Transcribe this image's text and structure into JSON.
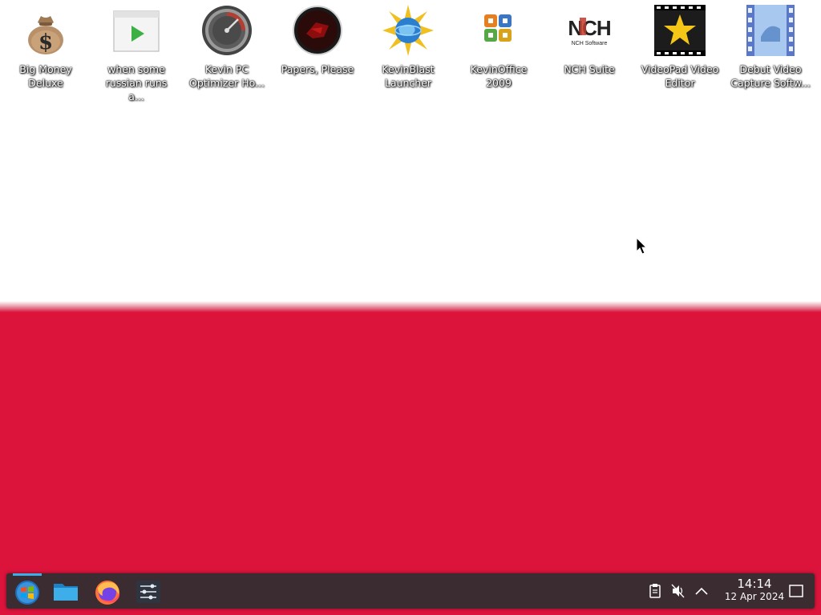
{
  "desktop": {
    "icons": [
      {
        "label": "Big Money Deluxe",
        "icon": "money-bag-icon"
      },
      {
        "label": "when some russian runs a...",
        "icon": "video-player-icon"
      },
      {
        "label": "Kevin PC Optimizer Ho...",
        "icon": "speedometer-icon"
      },
      {
        "label": "Papers, Please",
        "icon": "papers-please-emblem-icon"
      },
      {
        "label": "KevinBlast Launcher",
        "icon": "globe-star-icon"
      },
      {
        "label": "KevinOffice 2009",
        "icon": "office-logo-icon"
      },
      {
        "label": "NCH Suite",
        "icon": "nch-logo-icon"
      },
      {
        "label": "VideoPad Video Editor",
        "icon": "film-star-icon"
      },
      {
        "label": "Debut Video Capture Softw...",
        "icon": "film-strip-icon"
      }
    ],
    "nch_logo_text": "NCH",
    "nch_logo_sub": "NCH Software"
  },
  "wallpaper": {
    "top_color": "#ffffff",
    "bottom_color": "#dc143c"
  },
  "taskbar": {
    "apps": [
      {
        "name": "start-menu",
        "icon": "windows-orb-icon"
      },
      {
        "name": "file-manager",
        "icon": "folder-icon"
      },
      {
        "name": "firefox",
        "icon": "firefox-icon"
      },
      {
        "name": "system-settings",
        "icon": "settings-sliders-icon"
      }
    ],
    "tray": [
      {
        "icon": "clipboard-icon"
      },
      {
        "icon": "volume-muted-icon"
      },
      {
        "icon": "chevron-up-icon"
      }
    ],
    "clock": {
      "time": "14:14",
      "date": "12 Apr 2024"
    },
    "accent": "#3daee9",
    "background": "#3a2c31"
  }
}
